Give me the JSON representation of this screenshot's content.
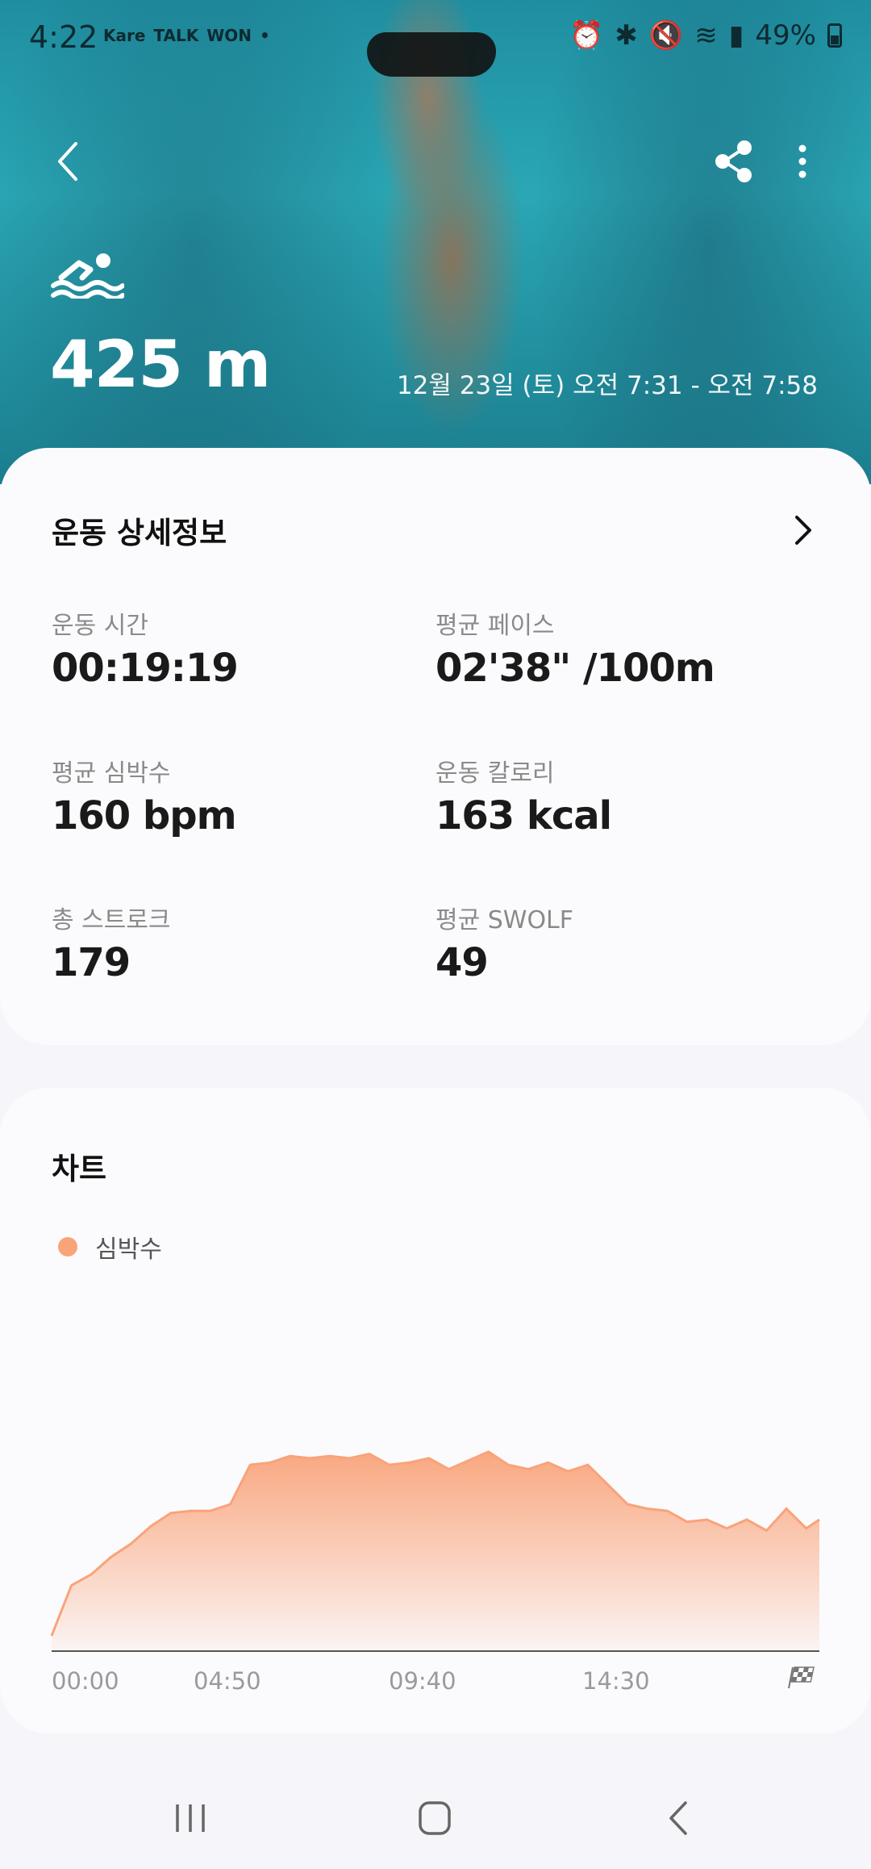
{
  "status_bar": {
    "time": "4:22",
    "apps": [
      "Kare",
      "TALK",
      "WON",
      "•"
    ],
    "battery": "49%",
    "icons": [
      "alarm-icon",
      "bluetooth-icon",
      "mute-icon",
      "wifi-icon",
      "hd-voice-icon",
      "signal-icon",
      "battery-icon"
    ]
  },
  "header": {
    "activity_icon": "swimming-icon",
    "distance": "425 m",
    "date_range": "12월 23일 (토) 오전 7:31 - 오전 7:58"
  },
  "details": {
    "title": "운동 상세정보",
    "stats": [
      {
        "label": "운동 시간",
        "value": "00:19:19"
      },
      {
        "label": "평균 페이스",
        "value": "02'38\" /100m"
      },
      {
        "label": "평균 심박수",
        "value": "160 bpm"
      },
      {
        "label": "운동 칼로리",
        "value": "163 kcal"
      },
      {
        "label": "총 스트로크",
        "value": "179"
      },
      {
        "label": "평균 SWOLF",
        "value": "49"
      }
    ]
  },
  "chart_section": {
    "title": "차트",
    "legend": "심박수"
  },
  "chart_data": {
    "type": "area",
    "x_tick_labels": [
      "00:00",
      "04:50",
      "09:40",
      "14:30"
    ],
    "series": [
      {
        "name": "심박수",
        "color": "#f9a37a",
        "x": [
          0,
          0.5,
          1,
          1.5,
          2,
          2.5,
          3,
          3.5,
          4,
          4.5,
          5,
          5.5,
          6,
          6.5,
          7,
          7.5,
          8,
          8.5,
          9,
          9.5,
          10,
          10.5,
          11,
          11.5,
          12,
          12.5,
          13,
          13.5,
          14,
          14.5,
          15,
          15.5,
          16,
          16.5,
          17,
          17.5,
          18,
          18.5,
          19,
          19.33
        ],
        "y": [
          92,
          115,
          120,
          128,
          134,
          142,
          148,
          149,
          149,
          152,
          170,
          171,
          174,
          173,
          174,
          173,
          175,
          170,
          171,
          173,
          168,
          172,
          176,
          170,
          168,
          171,
          167,
          170,
          161,
          152,
          150,
          149,
          144,
          145,
          141,
          145,
          140,
          150,
          141,
          145
        ]
      }
    ]
  }
}
